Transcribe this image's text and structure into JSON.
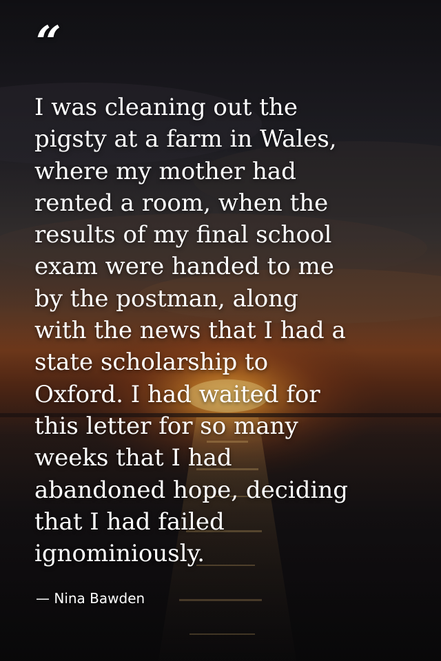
{
  "quote": {
    "mark": "“",
    "text": "I was cleaning out the\npigsty at a farm in Wales,\nwhere my mother had\nrented a room, when the\nresults of my final school\nexam were handed to me\nby the postman, along\nwith the news that I had a\nstate scholarship to\nOxford. I had waited for\nthis letter for so many\nweeks that I had\nabandoned hope, deciding\nthat I had failed\nignominiously.",
    "author": "— Nina Bawden"
  },
  "colors": {
    "text": "#ffffff",
    "sky_top": "#17161b",
    "sun_glow": "#c1561a",
    "water": "#0f0d10"
  }
}
